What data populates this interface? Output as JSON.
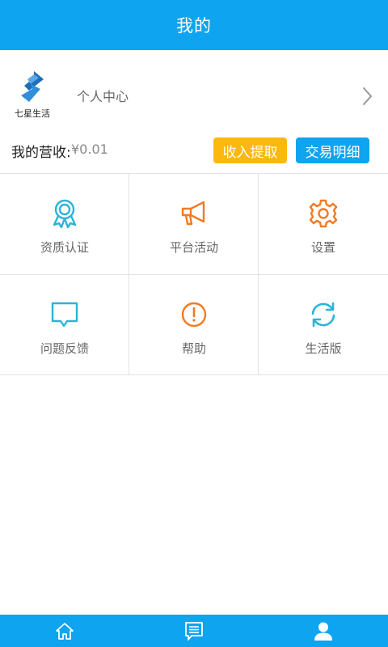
{
  "header": {
    "title": "我的"
  },
  "profile": {
    "logo_caption": "七星生活",
    "label": "个人中心"
  },
  "revenue": {
    "label": "我的营收:",
    "value": "¥0.01",
    "withdraw_label": "收入提取",
    "detail_label": "交易明细"
  },
  "grid": {
    "items": [
      {
        "label": "资质认证",
        "icon": "badge-icon"
      },
      {
        "label": "平台活动",
        "icon": "megaphone-icon"
      },
      {
        "label": "设置",
        "icon": "gear-icon"
      },
      {
        "label": "问题反馈",
        "icon": "chat-bubble-icon"
      },
      {
        "label": "帮助",
        "icon": "alert-circle-icon"
      },
      {
        "label": "生活版",
        "icon": "refresh-icon"
      }
    ]
  },
  "tabbar": {
    "tabs": [
      {
        "icon": "home-icon"
      },
      {
        "icon": "message-icon"
      },
      {
        "icon": "user-icon",
        "selected": true
      }
    ]
  },
  "colors": {
    "primary": "#0ea4ef",
    "accent_orange": "#f47a20",
    "accent_yellow": "#fcb80e",
    "accent_cyan": "#2bb4d8"
  }
}
